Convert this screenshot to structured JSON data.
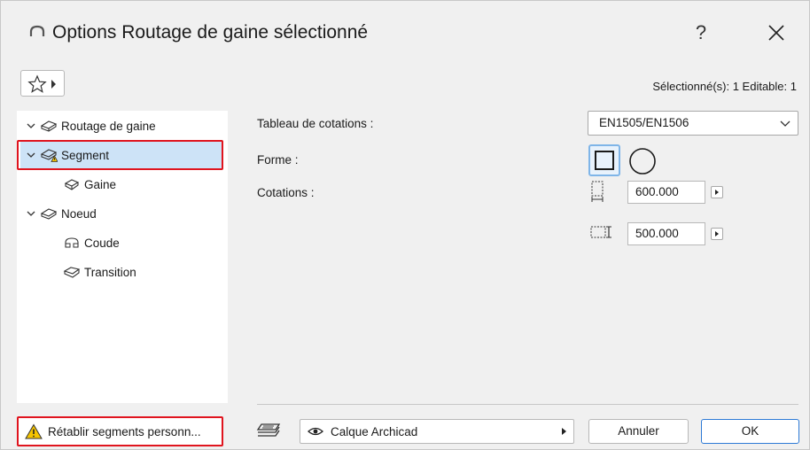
{
  "window": {
    "title": "Options Routage de gaine sélectionné",
    "help_label": "?",
    "status": "Sélectionné(s): 1 Editable: 1"
  },
  "tree": {
    "items": [
      {
        "label": "Routage de gaine",
        "icon": "duct-routing-icon",
        "level": 0,
        "expanded": true
      },
      {
        "label": "Segment",
        "icon": "duct-segment-warning-icon",
        "level": 1,
        "expanded": true,
        "selected": true
      },
      {
        "label": "Gaine",
        "icon": "duct-icon",
        "level": 2
      },
      {
        "label": "Noeud",
        "icon": "duct-node-icon",
        "level": 1,
        "expanded": true
      },
      {
        "label": "Coude",
        "icon": "elbow-icon",
        "level": 2
      },
      {
        "label": "Transition",
        "icon": "transition-icon",
        "level": 2
      }
    ],
    "reset_label": "Rétablir segments personn..."
  },
  "form": {
    "rating_label": "Tableau de cotations :",
    "rating_value": "EN1505/EN1506",
    "shape_label": "Forme :",
    "shape_selected": "rectangle",
    "dimensions_label": "Cotations :",
    "width_value": "600.000",
    "height_value": "500.000"
  },
  "footer": {
    "layer_value": "Calque Archicad",
    "cancel_label": "Annuler",
    "ok_label": "OK"
  },
  "colors": {
    "highlight_box": "#e0141e",
    "selected_row": "#cde3f7",
    "primary_button_border": "#2d7ad6"
  }
}
